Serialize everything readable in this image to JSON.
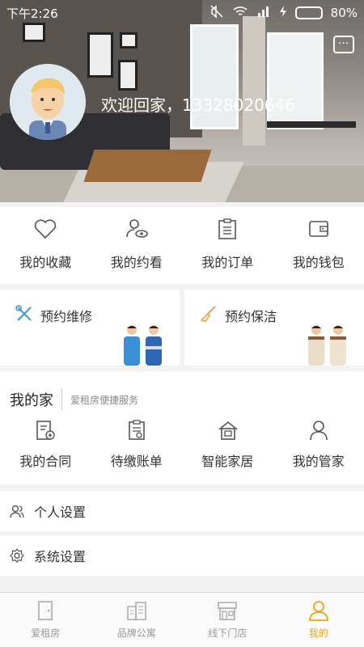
{
  "status_bar": {
    "time": "下午2:26",
    "battery": "80%",
    "battery_level": 0.8
  },
  "header": {
    "welcome": "欢迎回家，13328020646"
  },
  "quick_menu": [
    {
      "label": "我的收藏",
      "icon": "heart-icon"
    },
    {
      "label": "我的约看",
      "icon": "user-eye-icon"
    },
    {
      "label": "我的订单",
      "icon": "clipboard-list-icon"
    },
    {
      "label": "我的钱包",
      "icon": "wallet-icon"
    }
  ],
  "services": [
    {
      "label": "预约维修",
      "icon": "wrench-screwdriver-icon"
    },
    {
      "label": "预约保洁",
      "icon": "broom-icon"
    }
  ],
  "my_home": {
    "title": "我的家",
    "subtitle": "爱租房便捷服务",
    "items": [
      {
        "label": "我的合同",
        "icon": "contract-icon"
      },
      {
        "label": "待缴账单",
        "icon": "bill-icon"
      },
      {
        "label": "智能家居",
        "icon": "smart-home-icon"
      },
      {
        "label": "我的管家",
        "icon": "housekeeper-icon"
      }
    ]
  },
  "settings": [
    {
      "label": "个人设置",
      "icon": "users-icon"
    },
    {
      "label": "系统设置",
      "icon": "settings-gear-icon"
    }
  ],
  "tabbar": [
    {
      "label": "爱租房",
      "icon": "door-icon",
      "active": false
    },
    {
      "label": "品牌公寓",
      "icon": "buildings-icon",
      "active": false
    },
    {
      "label": "线下门店",
      "icon": "store-icon",
      "active": false
    },
    {
      "label": "我的",
      "icon": "person-icon",
      "active": true
    }
  ],
  "colors": {
    "accent": "#f2a30f",
    "battery": "#6ee05a"
  }
}
